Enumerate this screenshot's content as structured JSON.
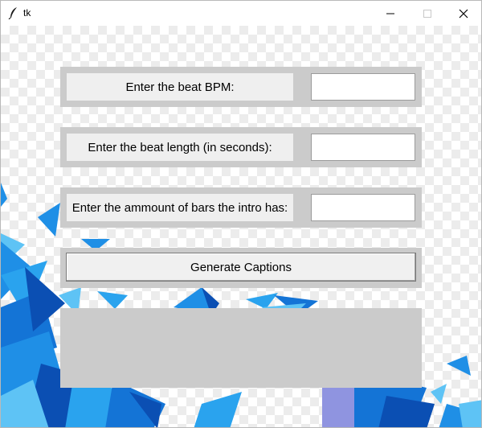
{
  "window": {
    "title": "tk",
    "controls": {
      "minimize": "minimize-icon",
      "maximize": "maximize-icon",
      "close": "close-icon"
    }
  },
  "form": {
    "bpm_label": "Enter the beat BPM:",
    "bpm_value": "",
    "length_label": "Enter the beat length (in seconds):",
    "length_value": "",
    "bars_label": "Enter the ammount of bars the intro has:",
    "bars_value": "",
    "generate_button": "Generate Captions",
    "output_text": ""
  },
  "colors": {
    "frame": "#cbcbcb",
    "label_bg": "#efefef",
    "entry_bg": "#ffffff",
    "crystal_blue": "#1f8fe6",
    "crystal_dark": "#0b4fb3",
    "crystal_light": "#5ec3f5"
  }
}
